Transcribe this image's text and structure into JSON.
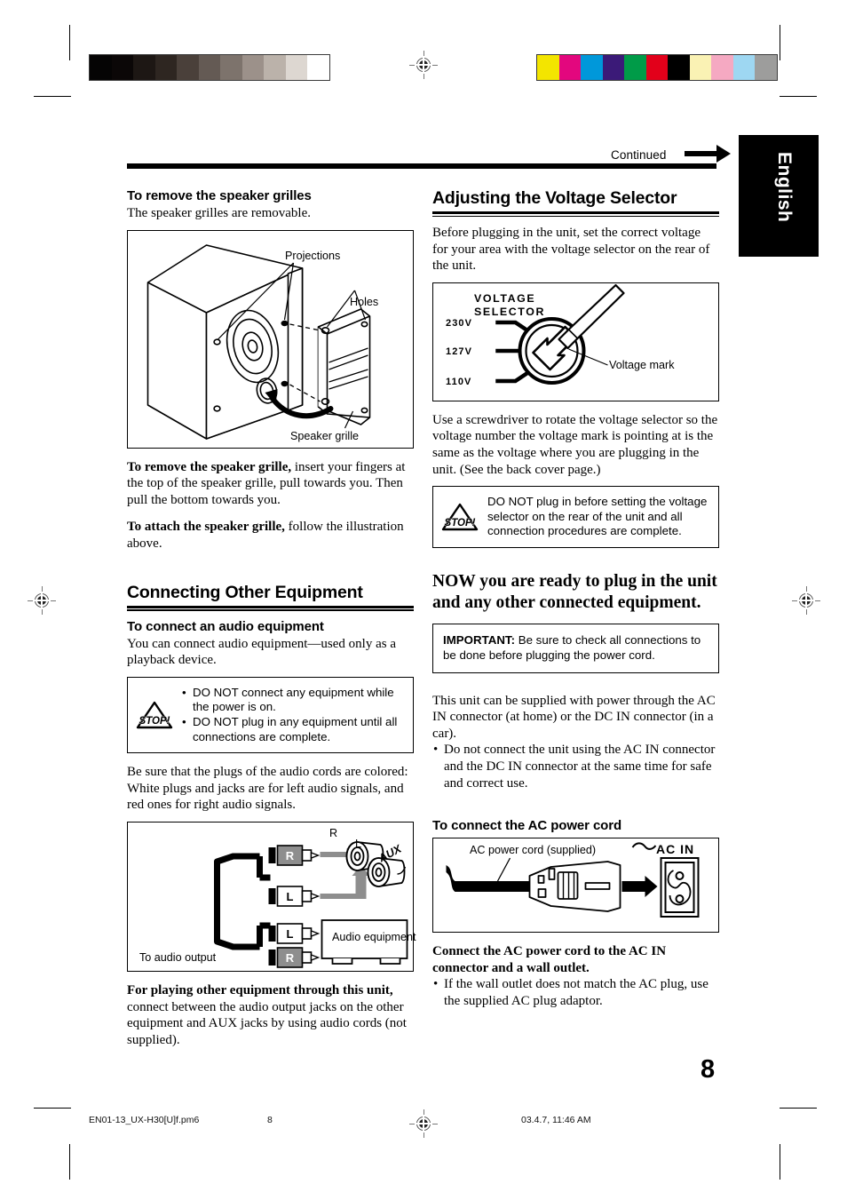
{
  "header": {
    "continued": "Continued",
    "language_tab": "English"
  },
  "left_column": {
    "grilles_heading": "To remove the speaker grilles",
    "grilles_intro": "The speaker grilles are removable.",
    "speaker_figure": {
      "label_projections": "Projections",
      "label_holes": "Holes",
      "label_speaker_grille": "Speaker grille"
    },
    "remove_lead": "To remove the speaker grille,",
    "remove_rest": " insert your fingers at the top of the speaker grille, pull towards you. Then pull the bottom towards you.",
    "attach_lead": "To attach the speaker grille,",
    "attach_rest": " follow the illustration above.",
    "connecting_heading": "Connecting Other Equipment",
    "audio_sub": "To connect an audio equipment",
    "audio_intro": "You can connect audio equipment—used only as a playback device.",
    "warn_audio": [
      "DO NOT connect any equipment while the power is on.",
      "DO NOT plug in any equipment until all connections are complete."
    ],
    "plug_colors": "Be sure that the plugs of the audio cords are colored: White plugs and jacks are for left audio signals, and red ones for right audio signals.",
    "audio_figure": {
      "jack_r": "R",
      "jack_l": "L",
      "aux": "AUX",
      "label_r_top": "R",
      "label_l_top": "L",
      "to_audio_output": "To audio output",
      "audio_equipment": "Audio equipment"
    },
    "playing_lead": "For playing other equipment through this unit,",
    "playing_rest": " connect between the audio output jacks on the other equipment and AUX jacks by using audio cords (not supplied)."
  },
  "right_column": {
    "voltage_heading": "Adjusting the Voltage Selector",
    "voltage_intro": "Before plugging in the unit, set the correct voltage for your area with the voltage selector on the rear of the unit.",
    "voltage_figure": {
      "title_line1": "VOLTAGE",
      "title_line2": "SELECTOR",
      "v230": "230V",
      "v127": "127V",
      "v110": "110V",
      "voltage_mark": "Voltage mark"
    },
    "screwdriver_text": "Use a screwdriver to rotate the voltage selector so the voltage number the voltage mark is pointing at is the same as the voltage where you are plugging in the unit. (See the back cover page.)",
    "warn_voltage": "DO NOT plug in before setting the voltage selector on the rear of the unit and all connection procedures are complete.",
    "now_ready": "NOW you are ready to plug in the unit and any other connected equipment.",
    "important_label": "IMPORTANT:",
    "important_text": " Be sure to check all connections to be done before plugging the power cord.",
    "power_supply_text": "This unit can be supplied with power through the AC IN connector (at home) or the DC IN connector (in a car).",
    "power_supply_bullet": "Do not connect the unit using the AC IN connector and the DC IN connector at the same time for safe and correct use.",
    "ac_cord_sub": "To connect the AC power cord",
    "ac_figure": {
      "cord_label": "AC power cord (supplied)",
      "ac_in": "AC IN"
    },
    "connect_lead": "Connect the AC power cord to the AC IN connector and a wall outlet.",
    "connect_bullet": "If the wall outlet does not match the AC plug, use the supplied AC plug adaptor."
  },
  "page_number": "8",
  "footer": {
    "filename": "EN01-13_UX-H30[U]f.pm6",
    "page": "8",
    "timestamp": "03.4.7, 11:46 AM"
  },
  "colors": {
    "grayscale_bar": [
      "#050404",
      "#0b0707",
      "#1d1714",
      "#2e2621",
      "#4a403a",
      "#645a54",
      "#7d736c",
      "#9c918a",
      "#bbb2aa",
      "#ddd7d1",
      "#ffffff"
    ],
    "color_bar": [
      "#f3e500",
      "#e3077e",
      "#0098da",
      "#3b1a78",
      "#009b48",
      "#e2001a",
      "#000000",
      "#faf2b4",
      "#f5a9c2",
      "#9ed7f2",
      "#9d9d9c"
    ]
  }
}
